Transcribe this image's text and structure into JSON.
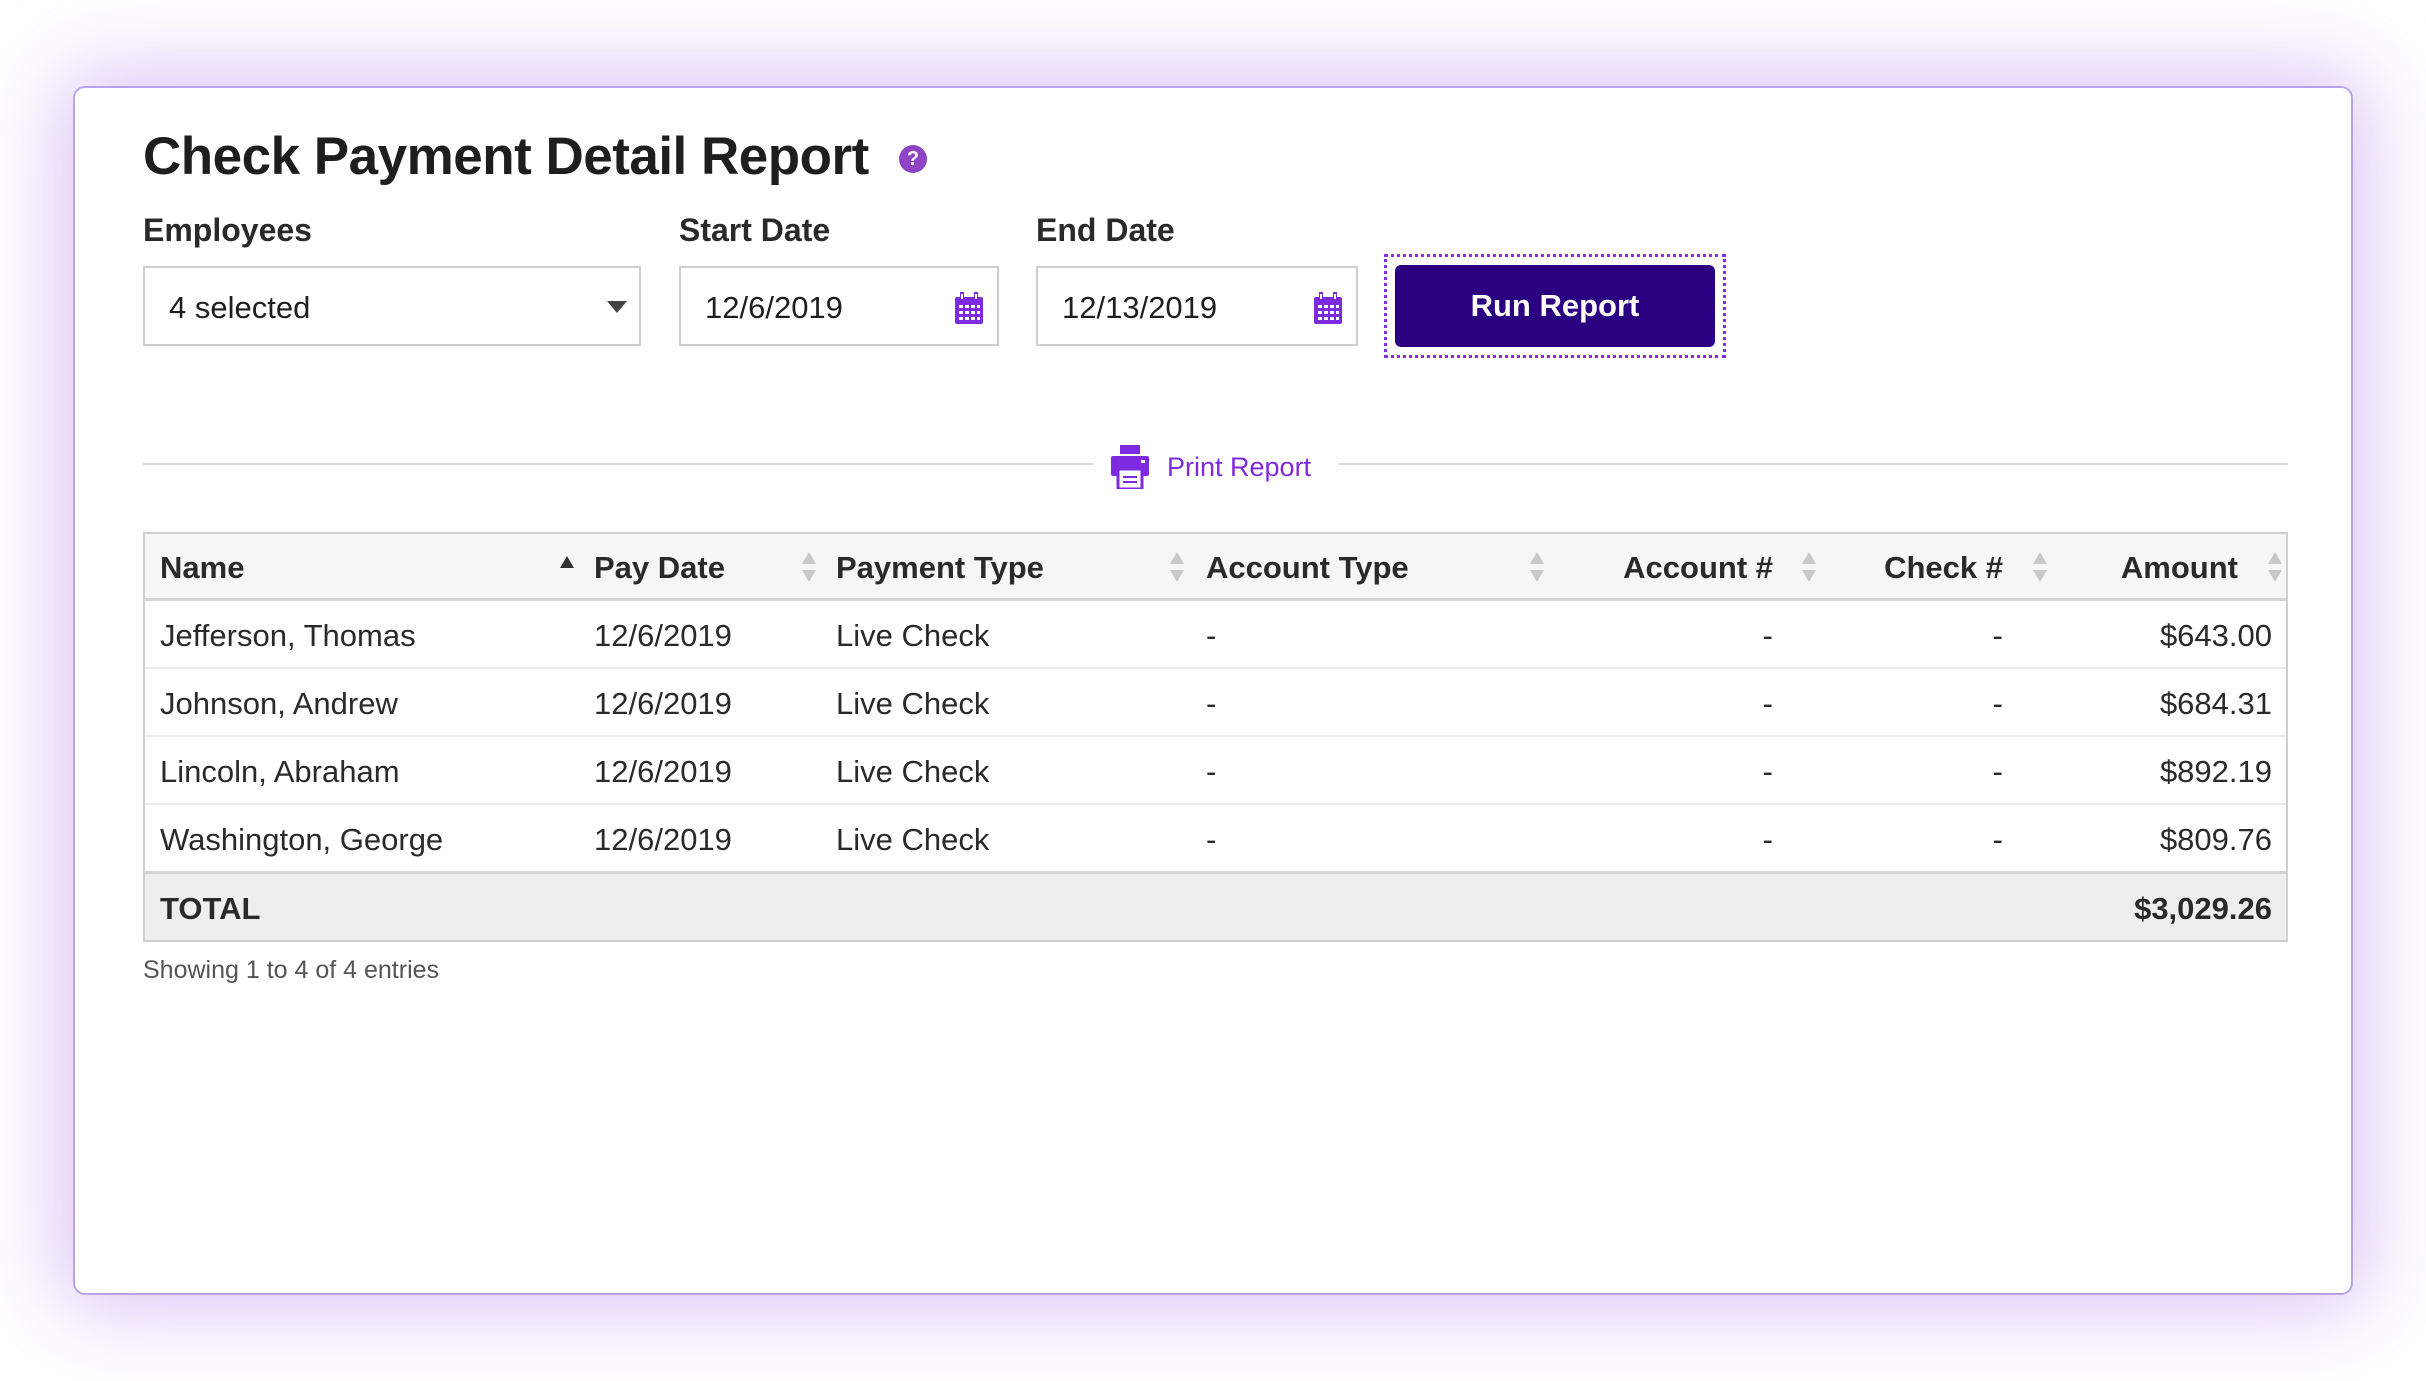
{
  "page": {
    "title": "Check Payment Detail Report",
    "help_icon": "question-circle-icon"
  },
  "filters": {
    "employees": {
      "label": "Employees",
      "value": "4 selected"
    },
    "start_date": {
      "label": "Start Date",
      "value": "12/6/2019",
      "icon": "calendar-icon"
    },
    "end_date": {
      "label": "End Date",
      "value": "12/13/2019",
      "icon": "calendar-icon"
    },
    "run_button": "Run Report"
  },
  "print": {
    "label": "Print Report",
    "icon": "printer-icon"
  },
  "table": {
    "columns": [
      "Name",
      "Pay Date",
      "Payment Type",
      "Account Type",
      "Account #",
      "Check #",
      "Amount"
    ],
    "sorted_column": "Name",
    "sort_direction": "ascending",
    "rows": [
      [
        "Jefferson, Thomas",
        "12/6/2019",
        "Live Check",
        "-",
        "-",
        "-",
        "$643.00"
      ],
      [
        "Johnson, Andrew",
        "12/6/2019",
        "Live Check",
        "-",
        "-",
        "-",
        "$684.31"
      ],
      [
        "Lincoln, Abraham",
        "12/6/2019",
        "Live Check",
        "-",
        "-",
        "-",
        "$892.19"
      ],
      [
        "Washington, George",
        "12/6/2019",
        "Live Check",
        "-",
        "-",
        "-",
        "$809.76"
      ]
    ],
    "total_label": "TOTAL",
    "total_amount": "$3,029.26"
  },
  "footer": {
    "showing": "Showing 1 to 4 of 4 entries"
  },
  "colors": {
    "accent": "#7d2ae0",
    "button": "#2a0080",
    "card_border": "#b7a3ec",
    "help_icon": "#8e44c4"
  }
}
